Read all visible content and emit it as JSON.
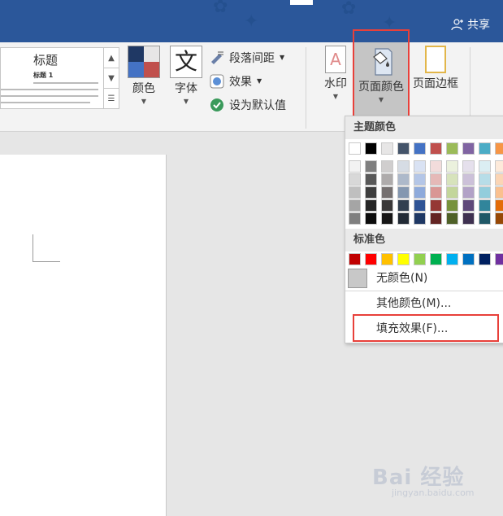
{
  "share": {
    "label": "共享",
    "icon": "add-person-icon"
  },
  "ribbon": {
    "style_gallery": {
      "title": "标题",
      "subtitle": "标题 1",
      "arrow_icons": [
        "chevron-up-icon",
        "chevron-down-icon",
        "more-icon"
      ]
    },
    "colors": {
      "label": "颜色",
      "swatch_colors": [
        "#1f3864",
        "#e7e6e6",
        "#4472c4",
        "#c0504d"
      ]
    },
    "fonts": {
      "label": "字体",
      "glyph": "文"
    },
    "paragraph_spacing": {
      "label": "段落间距"
    },
    "effects": {
      "label": "效果"
    },
    "set_default": {
      "label": "设为默认值"
    },
    "watermark": {
      "label": "水印",
      "glyph": "A"
    },
    "page_color": {
      "label": "页面颜色"
    },
    "page_borders": {
      "label": "页面边框"
    }
  },
  "dropdown": {
    "theme_header": "主题颜色",
    "standard_header": "标准色",
    "theme_top_row": [
      "#ffffff",
      "#000000",
      "#e7e6e6",
      "#44546a",
      "#4472c4",
      "#c0504d",
      "#9bbb59",
      "#8064a2",
      "#4bacc6",
      "#f79646"
    ],
    "theme_shades": [
      [
        "#f2f2f2",
        "#7f7f7f",
        "#d0cece",
        "#d6dce4",
        "#d9e2f3",
        "#f2dcdb",
        "#ebf1dd",
        "#e5e0ec",
        "#dbeef3",
        "#fdeada"
      ],
      [
        "#d8d8d8",
        "#595959",
        "#aeabab",
        "#adb9ca",
        "#b4c6e7",
        "#e5b9b7",
        "#d7e3bc",
        "#ccc1d9",
        "#b7dde8",
        "#fbd5b5"
      ],
      [
        "#bfbfbf",
        "#3f3f3f",
        "#757070",
        "#8497b0",
        "#8eaadb",
        "#d99694",
        "#c3d69b",
        "#b2a2c7",
        "#92cddc",
        "#fac08f"
      ],
      [
        "#a5a5a5",
        "#262626",
        "#3a3838",
        "#323f4f",
        "#2f5496",
        "#953734",
        "#76923c",
        "#5f497a",
        "#31859b",
        "#e36c09"
      ],
      [
        "#7f7f7f",
        "#0c0c0c",
        "#171616",
        "#222a35",
        "#1f3864",
        "#632423",
        "#4f6128",
        "#3f3151",
        "#205867",
        "#974806"
      ]
    ],
    "standard_colors": [
      "#c00000",
      "#ff0000",
      "#ffc000",
      "#ffff00",
      "#92d050",
      "#00b050",
      "#00b0f0",
      "#0070c0",
      "#002060",
      "#7030a0"
    ],
    "no_color": "无颜色(N)",
    "more_colors": "其他颜色(M)...",
    "fill_effects": "填充效果(F)...",
    "highlight_color": "#e8403a"
  },
  "watermark_logo": {
    "text": "Bai 经验",
    "sub": "jingyan.baidu.com"
  }
}
